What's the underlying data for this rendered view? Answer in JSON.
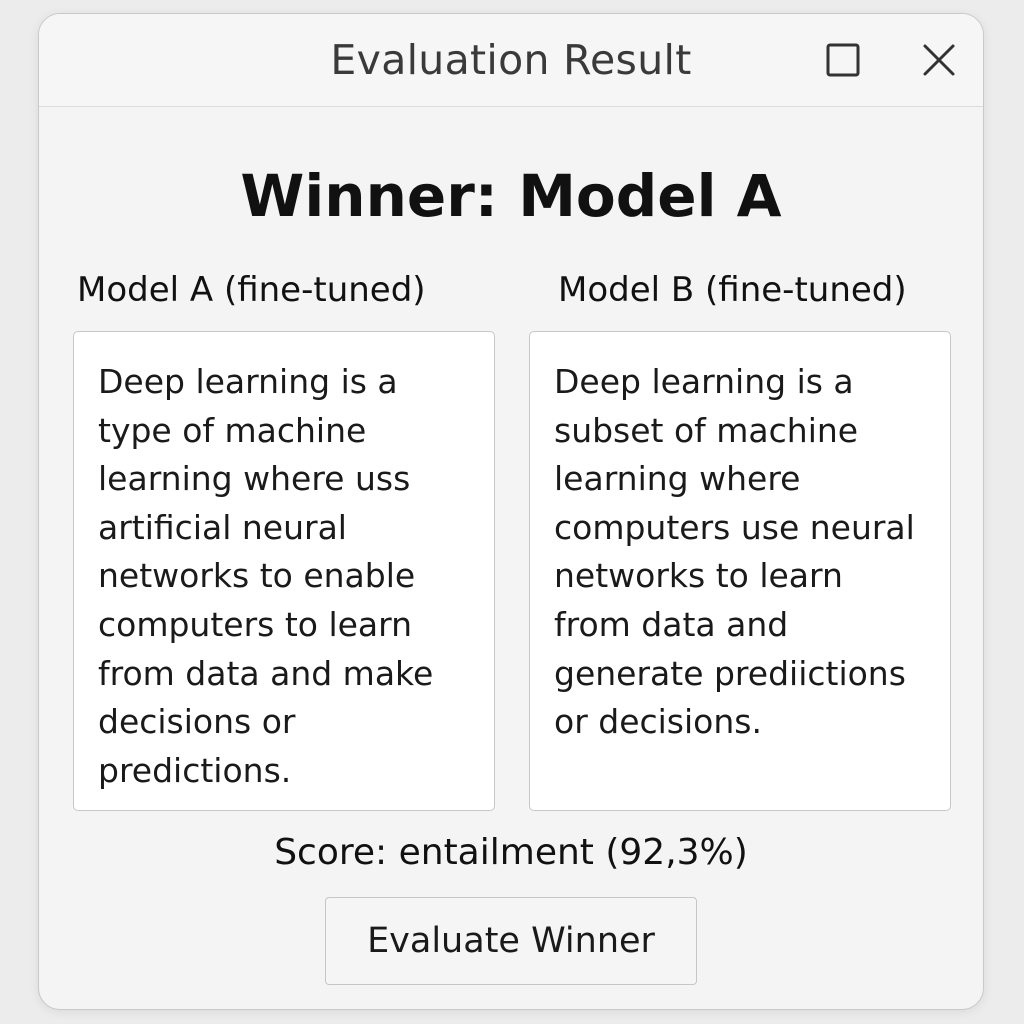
{
  "window": {
    "title": "Evaluation Result",
    "controls": {
      "maximize_icon": "maximize-icon",
      "close_icon": "close-icon"
    }
  },
  "result": {
    "winner_text": "Winner: Model A",
    "score_text": "Score: entailment (92,3%)"
  },
  "model_a": {
    "label": "Model A (fine-tuned)",
    "lines": [
      "Deep learning is a",
      "type of machine",
      "learning where uss",
      "artificial neural",
      "networks to enable",
      "computers to learn",
      "from data and make",
      "decisions or",
      "predictions."
    ]
  },
  "model_b": {
    "label": "Model B (fine-tuned)",
    "lines": [
      "Deep learning is a",
      "subset of machine",
      "learning where",
      "computers use neural",
      "networks to learn",
      "from data and",
      "generate prediictions",
      "or decisions."
    ]
  },
  "actions": {
    "evaluate_label": "Evaluate Winner"
  },
  "colors": {
    "window_bg": "#f4f4f4",
    "text": "#111111",
    "title_text": "#3a3a3a",
    "border": "#c8c8c8"
  }
}
